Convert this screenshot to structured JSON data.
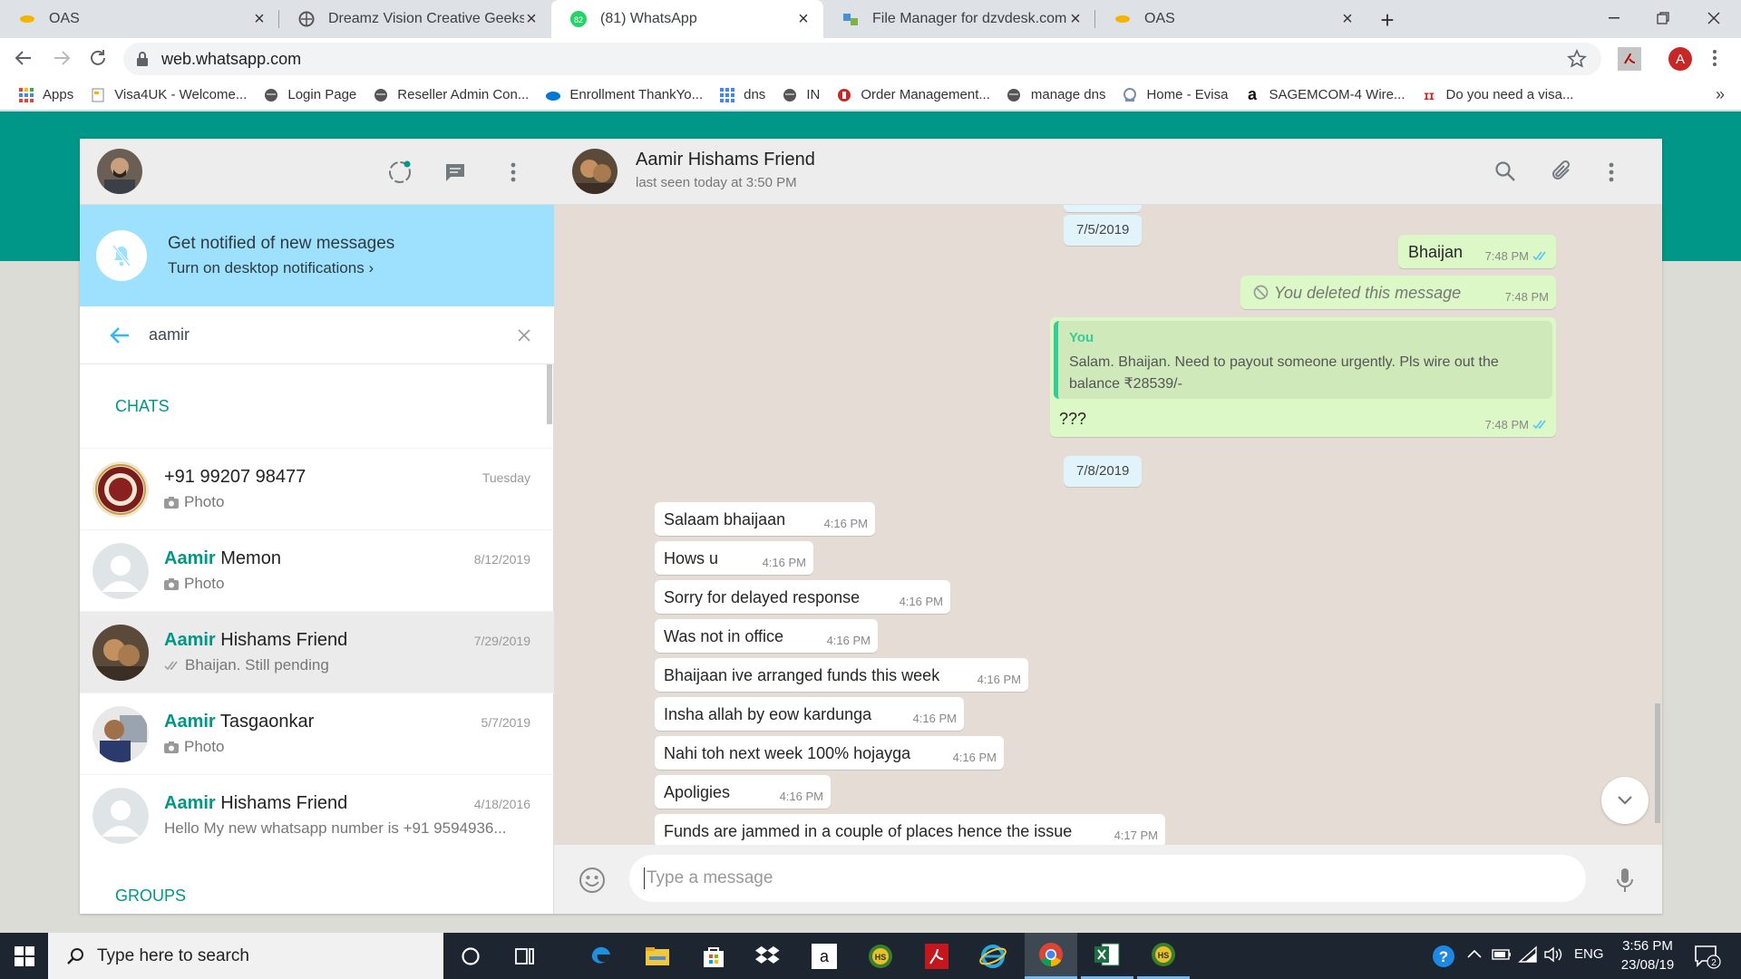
{
  "browser": {
    "tabs": [
      {
        "title": "OAS",
        "icon": "oas-icon",
        "active": false
      },
      {
        "title": "Dreamz Vision Creative Geeks Pv",
        "icon": "globe-icon",
        "active": false
      },
      {
        "title": "(81) WhatsApp",
        "icon": "whatsapp-icon",
        "badge": "82",
        "active": true
      },
      {
        "title": "File Manager for dzvdesk.com - F",
        "icon": "filemanager-icon",
        "active": false
      },
      {
        "title": "OAS",
        "icon": "oas-icon",
        "active": false
      }
    ],
    "url": "web.whatsapp.com",
    "profile_initial": "A",
    "bookmarks": [
      {
        "label": "Apps",
        "icon": "apps-grid-icon"
      },
      {
        "label": "Visa4UK - Welcome...",
        "icon": "page-icon"
      },
      {
        "label": "Login Page",
        "icon": "globe-icon"
      },
      {
        "label": "Reseller Admin Con...",
        "icon": "globe-icon"
      },
      {
        "label": "Enrollment ThankYo...",
        "icon": "cloud-icon"
      },
      {
        "label": "dns",
        "icon": "grid-icon"
      },
      {
        "label": "IN",
        "icon": "globe-icon"
      },
      {
        "label": "Order Management...",
        "icon": "order-icon"
      },
      {
        "label": "manage dns",
        "icon": "globe-icon"
      },
      {
        "label": "Home - Evisa",
        "icon": "evisa-icon"
      },
      {
        "label": "SAGEMCOM-4 Wire...",
        "icon": "amazon-icon"
      },
      {
        "label": "Do you need a visa...",
        "icon": "visa-icon"
      }
    ],
    "bookmarks_more": "»"
  },
  "sidebar": {
    "notification": {
      "title": "Get notified of new messages",
      "subtitle": "Turn on desktop notifications ›"
    },
    "search_value": "aamir",
    "section_chats": "CHATS",
    "section_groups": "GROUPS",
    "chats": [
      {
        "name_match": "",
        "name_rest": "+91 99207 98477",
        "time": "Tuesday",
        "preview": "Photo",
        "preview_icon": "camera-icon",
        "avatar": "emblem-avatar"
      },
      {
        "name_match": "Aamir",
        "name_rest": " Memon",
        "time": "8/12/2019",
        "preview": "Photo",
        "preview_icon": "camera-icon",
        "avatar": "default-avatar"
      },
      {
        "name_match": "Aamir",
        "name_rest": " Hishams Friend",
        "time": "7/29/2019",
        "preview": "Bhaijan. Still pending",
        "preview_icon": "double-tick-icon",
        "avatar": "photo-avatar",
        "selected": true
      },
      {
        "name_match": "Aamir",
        "name_rest": " Tasgaonkar",
        "time": "5/7/2019",
        "preview": "Photo",
        "preview_icon": "camera-icon",
        "avatar": "photo-avatar"
      },
      {
        "name_match": "Aamir",
        "name_rest": " Hishams Friend",
        "time": "4/18/2016",
        "preview": "Hello My new whatsapp number is +91 9594936...",
        "preview_icon": "",
        "avatar": "default-avatar"
      }
    ]
  },
  "conversation": {
    "contact_name": "Aamir Hishams Friend",
    "status": "last seen today at 3:50 PM",
    "date_partial": "7/5/2019",
    "date_1": "7/5/2019",
    "date_2": "7/8/2019",
    "outgoing": [
      {
        "text": "Bhaijan",
        "time": "7:48 PM"
      },
      {
        "text": "You deleted this message",
        "time": "7:48 PM",
        "deleted": true
      },
      {
        "quote_author": "You",
        "quote_text": "Salam. Bhaijan. Need to payout someone urgently. Pls wire out the balance ₹28539/-",
        "text": "???",
        "time": "7:48 PM"
      }
    ],
    "incoming": [
      {
        "text": "Salaam bhaijaan",
        "time": "4:16 PM"
      },
      {
        "text": "Hows u",
        "time": "4:16 PM"
      },
      {
        "text": "Sorry for delayed response",
        "time": "4:16 PM"
      },
      {
        "text": "Was not in office",
        "time": "4:16 PM"
      },
      {
        "text": "Bhaijaan ive arranged funds this week",
        "time": "4:16 PM"
      },
      {
        "text": "Insha allah by eow kardunga",
        "time": "4:16 PM"
      },
      {
        "text": "Nahi toh next week 100% hojayga",
        "time": "4:16 PM"
      },
      {
        "text": "Apoligies",
        "time": "4:16 PM"
      },
      {
        "text": "Funds are jammed in a couple of places hence the issue",
        "time": "4:17 PM"
      }
    ],
    "composer_placeholder": "Type a message"
  },
  "taskbar": {
    "search_placeholder": "Type here to search",
    "language": "ENG",
    "time": "3:56 PM",
    "date": "23/08/19",
    "notification_count": "2"
  },
  "colors": {
    "teal": "#009688",
    "outgoing_bubble": "#dcf8c6",
    "chat_bg": "#e5ddd5",
    "tick_blue": "#4fc3f7"
  }
}
